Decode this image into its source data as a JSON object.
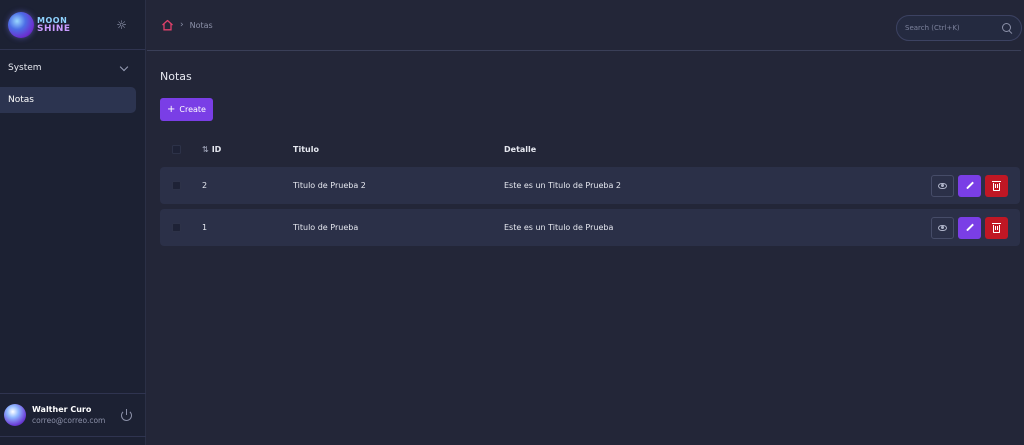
{
  "brand": {
    "line1": "MOON",
    "line2": "SHINE"
  },
  "sidebar": {
    "group_label": "System",
    "items": [
      {
        "label": "Notas",
        "active": true
      }
    ]
  },
  "user": {
    "name": "Walther Curo",
    "email": "correo@correo.com"
  },
  "breadcrumb": {
    "current": "Notas"
  },
  "search": {
    "placeholder": "Search (Ctrl+K)"
  },
  "page": {
    "title": "Notas",
    "create_label": "Create"
  },
  "table": {
    "columns": {
      "id": "ID",
      "title": "Titulo",
      "detail": "Detalle"
    },
    "rows": [
      {
        "id": "2",
        "title": "Titulo de Prueba 2",
        "detail": "Este es un Titulo de Prueba 2"
      },
      {
        "id": "1",
        "title": "Titulo de Prueba",
        "detail": "Este es un Titulo de Prueba"
      }
    ]
  },
  "colors": {
    "accent": "#7a3ee6",
    "danger": "#c01724",
    "sidebar_bg": "#1c2133",
    "main_bg": "#232638",
    "row_bg": "#2b3048"
  },
  "icons": [
    "sun-icon",
    "chevron-down-icon",
    "power-icon",
    "home-icon",
    "search-icon",
    "plus-icon",
    "sort-icon",
    "eye-icon",
    "pencil-icon",
    "trash-icon"
  ]
}
